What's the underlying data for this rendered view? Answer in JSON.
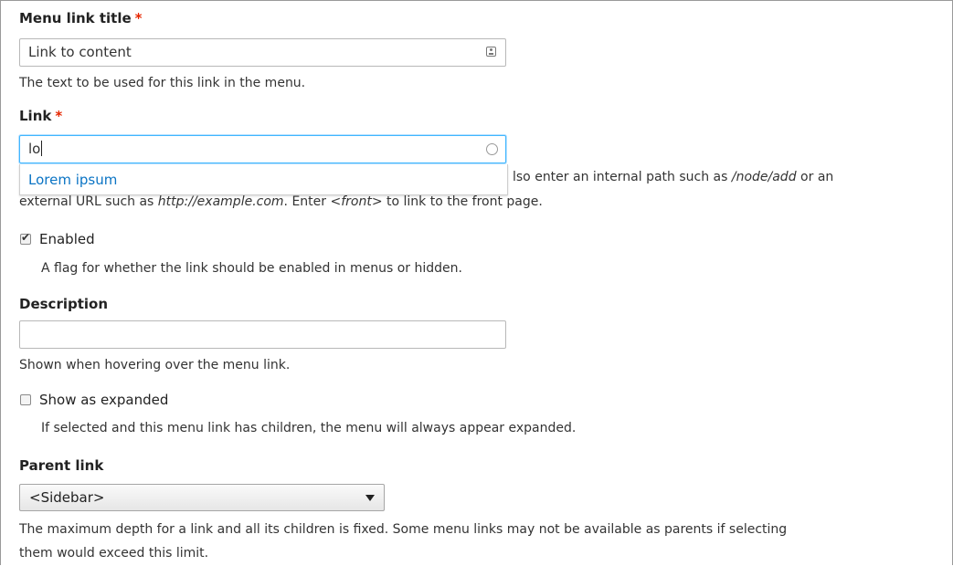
{
  "menu_link_title": {
    "label": "Menu link title",
    "required_mark": "*",
    "value": "Link to content",
    "help": "The text to be used for this link in the menu."
  },
  "link": {
    "label": "Link",
    "required_mark": "*",
    "value": "lo",
    "autocomplete_option": "Lorem ipsum",
    "help_line1_visible": "lso enter an internal path such as ",
    "help_line1_path": "/node/add",
    "help_line1_tail": " or an",
    "help_line2_a": "external URL such as ",
    "help_line2_example": "http://example.com",
    "help_line2_b": ". Enter ",
    "help_line2_front": "<front>",
    "help_line2_c": " to link to the front page."
  },
  "enabled": {
    "label": "Enabled",
    "checked": true,
    "help": "A flag for whether the link should be enabled in menus or hidden."
  },
  "description": {
    "label": "Description",
    "value": "",
    "help": "Shown when hovering over the menu link."
  },
  "expanded": {
    "label": "Show as expanded",
    "checked": false,
    "help": "If selected and this menu link has children, the menu will always appear expanded."
  },
  "parent_link": {
    "label": "Parent link",
    "selected": "<Sidebar>",
    "help_line1": "The maximum depth for a link and all its children is fixed. Some menu links may not be available as parents if selecting",
    "help_line2": "them would exceed this limit."
  },
  "colors": {
    "required": "#e62600",
    "focus_border": "#40b6ff",
    "link_option": "#0b74c4"
  }
}
